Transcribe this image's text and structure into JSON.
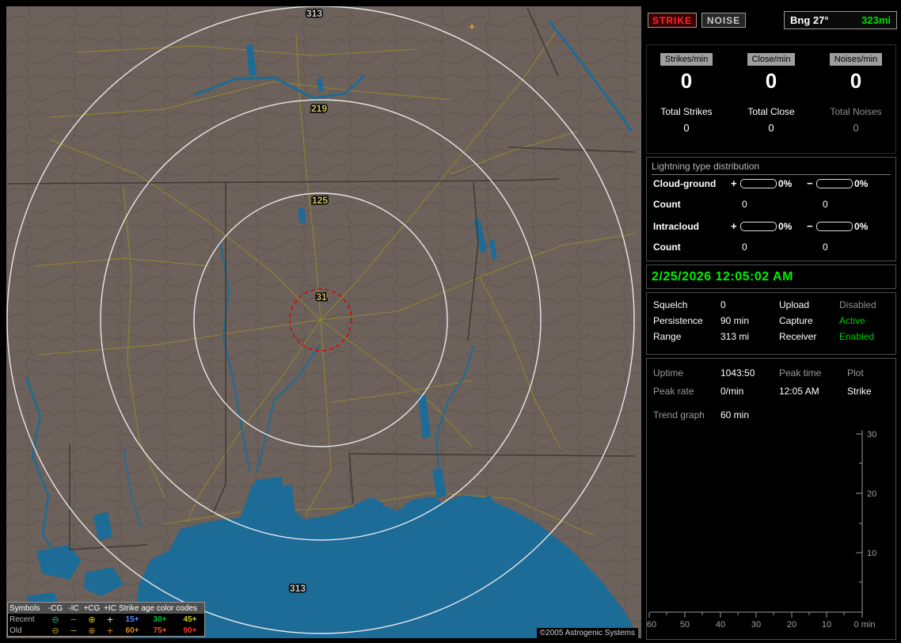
{
  "map": {
    "ring_labels": [
      "313",
      "219",
      "125",
      "31",
      "313"
    ],
    "marker_plus": "+",
    "copyright": "©2005 Astrogenic Systems",
    "legend": {
      "symbols_title": "Symbols",
      "columns": [
        "-CG",
        "-IC",
        "+CG",
        "+IC"
      ],
      "age_title": "Strike age color codes",
      "recent_label": "Recent",
      "old_label": "Old",
      "symbols": [
        "⊖",
        "−",
        "⊕",
        "+"
      ],
      "ages_recent": [
        "15+",
        "30+",
        "45+"
      ],
      "ages_old": [
        "60+",
        "75+",
        "90+"
      ]
    }
  },
  "sidebar": {
    "controls": {
      "strike": "STRIKE",
      "noise": "NOISE",
      "bearing": "Bng 27°",
      "range": "323mi"
    },
    "stats": {
      "columns": [
        {
          "badge": "Strikes/min",
          "rate": "0",
          "total_label": "Total Strikes",
          "total": "0"
        },
        {
          "badge": "Close/min",
          "rate": "0",
          "total_label": "Total Close",
          "total": "0"
        },
        {
          "badge": "Noises/min",
          "rate": "0",
          "total_label": "Total Noises",
          "total": "0"
        }
      ]
    },
    "distribution": {
      "title": "Lightning type distribution",
      "plus_sign": "+",
      "minus_sign": "−",
      "rows": [
        {
          "label": "Cloud-ground",
          "plus_pct": "0%",
          "minus_pct": "0%"
        },
        {
          "label": "Count",
          "plus_count": "0",
          "minus_count": "0"
        },
        {
          "label": "Intracloud",
          "plus_pct": "0%",
          "minus_pct": "0%"
        },
        {
          "label": "Count",
          "plus_count": "0",
          "minus_count": "0"
        }
      ]
    },
    "datetime": "2/25/2026 12:05:02 AM",
    "settings": {
      "rows": [
        {
          "label1": "Squelch",
          "value1": "0",
          "label2": "Upload",
          "value2": "Disabled"
        },
        {
          "label1": "Persistence",
          "value1": "90 min",
          "label2": "Capture",
          "value2": "Active"
        },
        {
          "label1": "Range",
          "value1": "313 mi",
          "label2": "Receiver",
          "value2": "Enabled"
        }
      ]
    },
    "status": {
      "uptime_label": "Uptime",
      "uptime": "1043:50",
      "peak_time_label": "Peak time",
      "peak_time": "12:05 AM",
      "plot_label": "Plot",
      "plot": "Strike",
      "peak_rate_label": "Peak rate",
      "peak_rate": "0/min",
      "trend_label": "Trend graph",
      "trend_value": "60 min"
    },
    "trend": {
      "y_ticks": [
        "30",
        "20",
        "10"
      ],
      "x_ticks": [
        "60",
        "50",
        "40",
        "30",
        "20",
        "10"
      ],
      "x_last": "0 min"
    }
  }
}
